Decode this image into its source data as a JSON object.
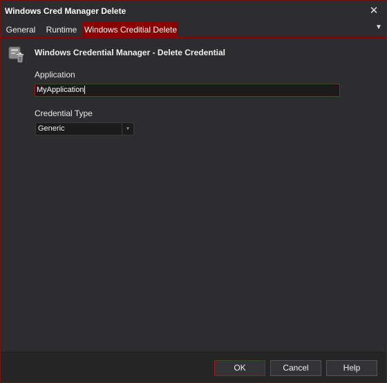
{
  "window": {
    "title": "Windows Cred Manager Delete",
    "close_glyph": "✕"
  },
  "tabs": [
    {
      "label": "General",
      "active": false
    },
    {
      "label": "Runtime",
      "active": false
    },
    {
      "label": "Windows Creditial Delete",
      "active": true
    }
  ],
  "tab_menu_glyph": "▼",
  "header": {
    "icon": "credential-delete-icon",
    "title": "Windows Credential Manager - Delete Credential"
  },
  "form": {
    "application_label": "Application",
    "application_value": "MyApplication",
    "credential_type_label": "Credential Type",
    "credential_type_value": "Generic",
    "dropdown_arrow_glyph": "▼"
  },
  "buttons": {
    "ok": "OK",
    "cancel": "Cancel",
    "help": "Help"
  },
  "colors": {
    "accent": "#8b0000",
    "background": "#2d2d30",
    "footer": "#252526",
    "text": "#f0f0f0"
  }
}
